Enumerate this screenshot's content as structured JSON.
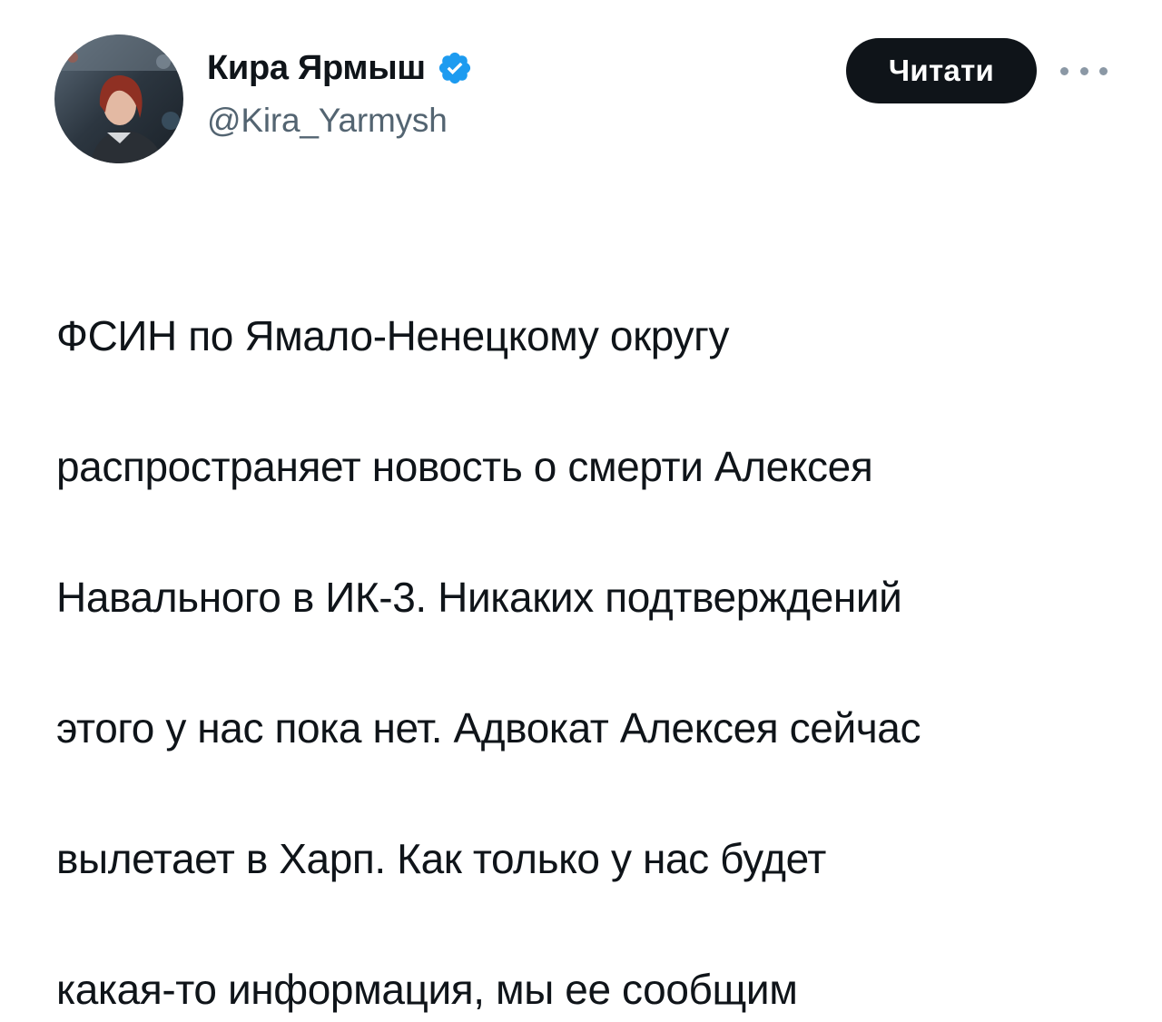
{
  "author": {
    "display_name": "Кира Ярмыш",
    "handle": "@Kira_Yarmysh",
    "verified": true,
    "verified_icon": "verified-badge-icon",
    "verified_color": "#1d9bf0",
    "avatar_alt": "avatar"
  },
  "actions": {
    "follow_label": "Читати",
    "more_icon": "more-dots-icon"
  },
  "tweet": {
    "lines": [
      "ФСИН по Ямало-Ненецкому округу",
      "распространяет новость о смерти Алексея",
      "Навального в ИК-3. Никаких подтверждений",
      "этого у нас пока нет. Адвокат Алексея сейчас",
      "вылетает в Харп. Как только у нас будет",
      "какая-то информация, мы ее сообщим"
    ]
  },
  "colors": {
    "text_primary": "#0f1419",
    "text_secondary": "#536471",
    "button_bg": "#0f1419",
    "button_text": "#ffffff",
    "accent": "#1d9bf0"
  }
}
